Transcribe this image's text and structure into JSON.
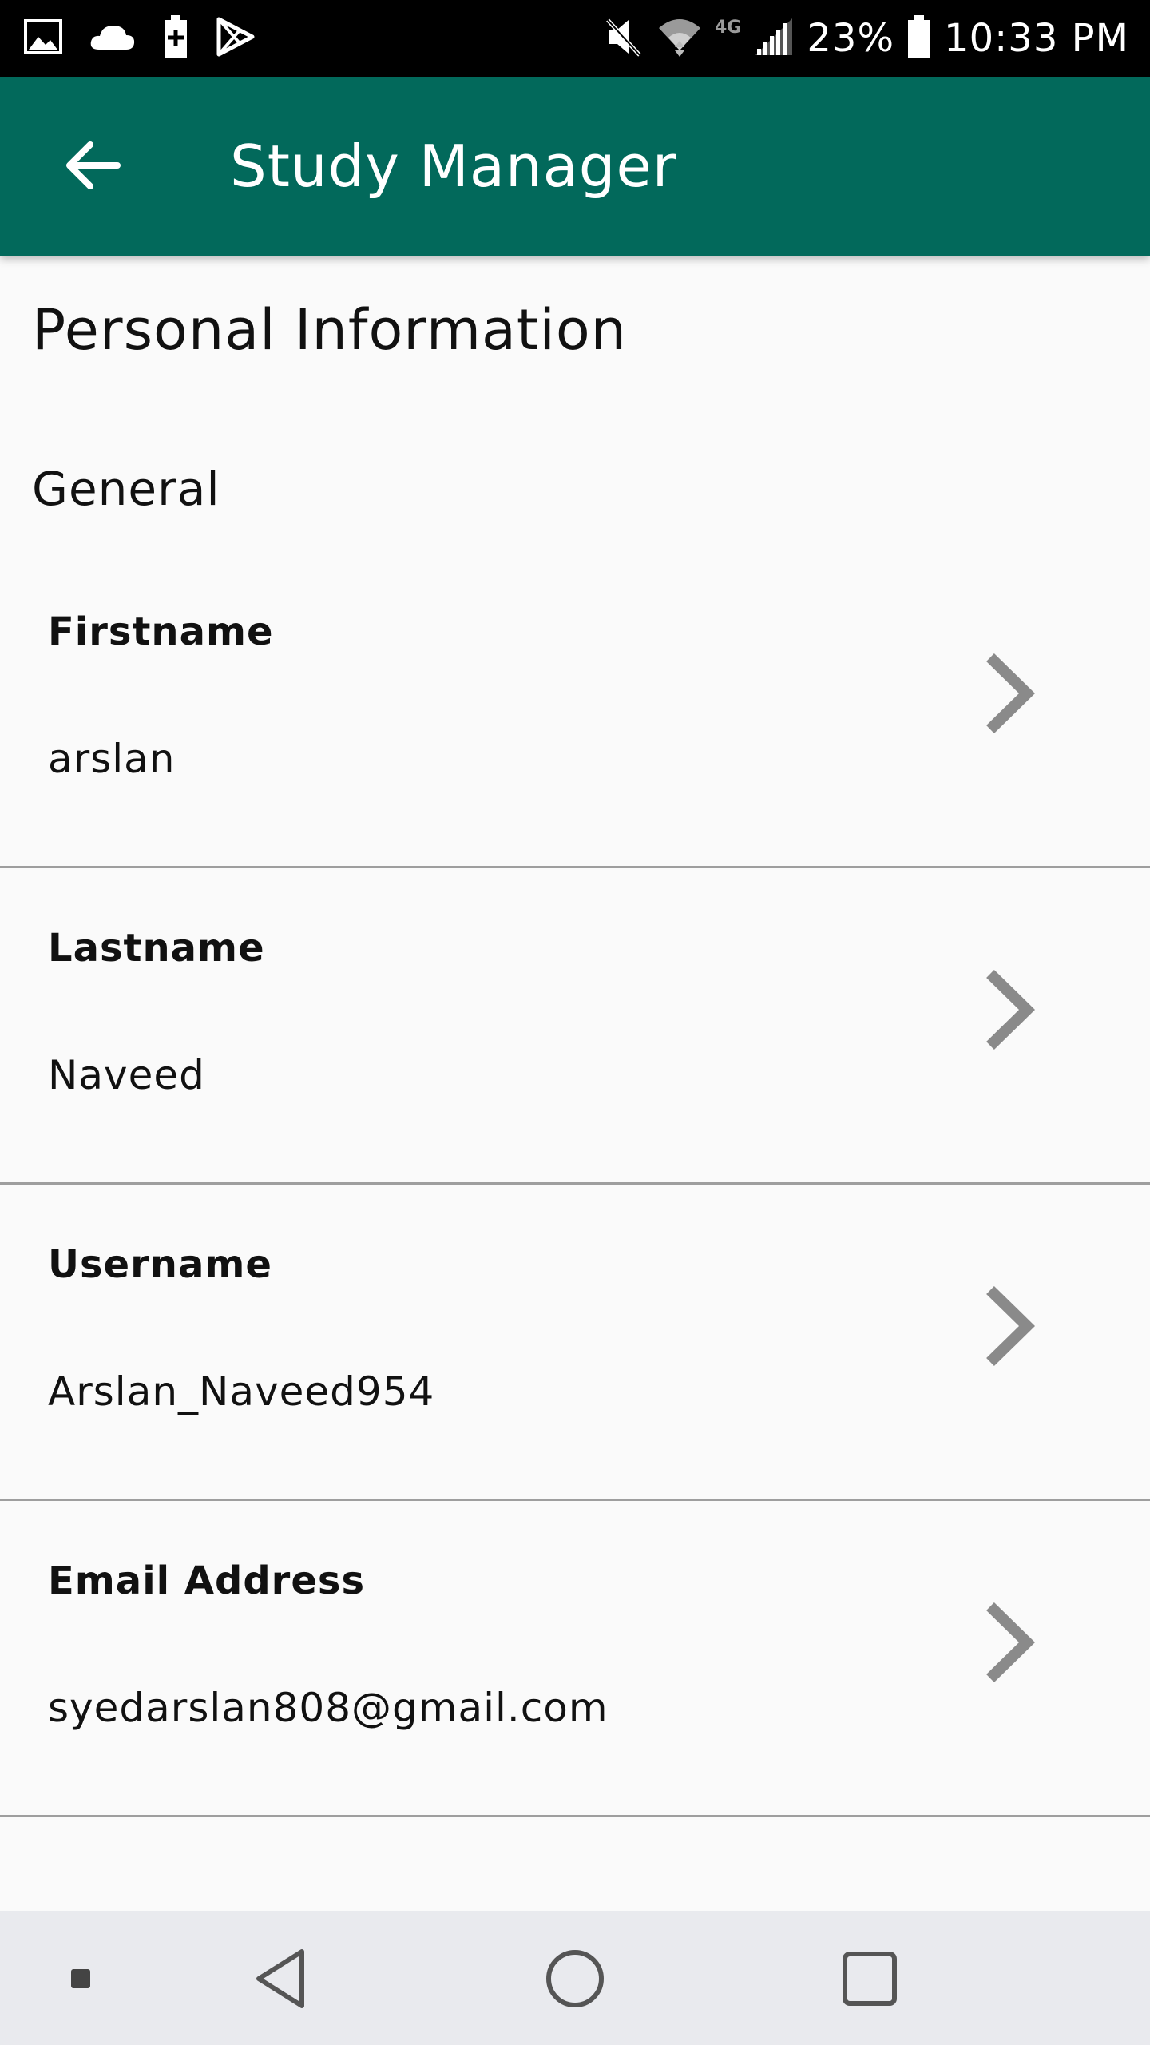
{
  "status_bar": {
    "battery_percent": "23%",
    "time": "10:33 PM",
    "network": "4G",
    "icons": [
      "image-icon",
      "cloud-icon",
      "battery-saver-icon",
      "play-store-icon",
      "mute-icon",
      "wifi-icon",
      "signal-icon",
      "battery-icon"
    ]
  },
  "app_bar": {
    "title": "Study Manager",
    "back_icon": "arrow-back-icon",
    "color": "#02695b"
  },
  "page": {
    "title": "Personal Information",
    "section": "General"
  },
  "fields": [
    {
      "label": "Firstname",
      "value": "arslan"
    },
    {
      "label": "Lastname",
      "value": "Naveed"
    },
    {
      "label": "Username",
      "value": "Arslan_Naveed954"
    },
    {
      "label": "Email Address",
      "value": "syedarslan808@gmail.com"
    }
  ],
  "nav_bar": {
    "buttons": [
      "recent-dot-icon",
      "back-triangle-icon",
      "home-circle-icon",
      "overview-square-icon"
    ]
  }
}
